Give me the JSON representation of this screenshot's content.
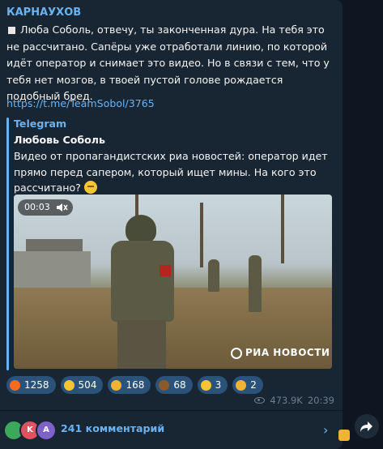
{
  "post": {
    "author": "КАРНАУХОВ",
    "text": "Люба Соболь, отвечу, ты законченная дура. На тебя это не рассчитано. Сапёры уже отработали линию, по которой идёт оператор и снимает это видео. Но в связи с тем, что у тебя нет мозгов, в твоей пустой голове рождается подобный бред.",
    "link": "https://t.me/TeamSobol/3765"
  },
  "quote": {
    "source": "Telegram",
    "author": "Любовь Соболь",
    "text": "Видео от пропагандистских риа новостей: оператор идет прямо перед сапером, который ищет мины. На кого это рассчитано?",
    "emoji": "thinking-face"
  },
  "video": {
    "time": "00:03",
    "watermark": "РИА НОВОСТИ"
  },
  "reactions": [
    {
      "icon": "fire-icon",
      "count": "1258",
      "color": "#f56b1f"
    },
    {
      "icon": "grin-icon",
      "count": "504",
      "color": "#f7c531"
    },
    {
      "icon": "thumbs-up-icon",
      "count": "168",
      "color": "#f2b233"
    },
    {
      "icon": "poop-icon",
      "count": "68",
      "color": "#8a5a2b"
    },
    {
      "icon": "crying-icon",
      "count": "3",
      "color": "#f7c531"
    },
    {
      "icon": "thumbs-down-icon",
      "count": "2",
      "color": "#f2b233"
    }
  ],
  "meta": {
    "views": "473.9K",
    "time": "20:39"
  },
  "comments": {
    "label": "241 комментарий",
    "avatars": [
      {
        "letter": "",
        "color": "#3ca85c"
      },
      {
        "letter": "K",
        "color": "#e05260"
      },
      {
        "letter": "A",
        "color": "#7e62c9"
      }
    ]
  }
}
